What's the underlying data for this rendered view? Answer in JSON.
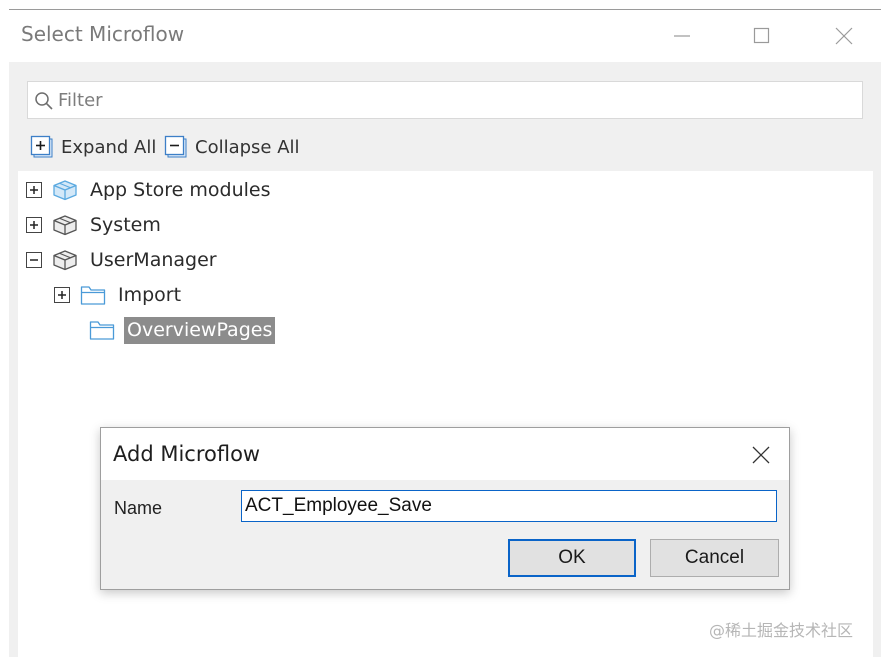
{
  "window": {
    "title": "Select Microflow"
  },
  "filter": {
    "placeholder": "Filter",
    "value": ""
  },
  "toolbar": {
    "expand_all": "Expand All",
    "collapse_all": "Collapse All"
  },
  "tree": {
    "items": [
      {
        "label": "App Store modules",
        "icon": "module-box-icon",
        "expander": "expand"
      },
      {
        "label": "System",
        "icon": "module-box-icon",
        "expander": "expand"
      },
      {
        "label": "UserManager",
        "icon": "module-box-icon",
        "expander": "collapse"
      },
      {
        "label": "Import",
        "icon": "folder-icon",
        "expander": "expand"
      },
      {
        "label": "OverviewPages",
        "icon": "folder-icon",
        "selected": true
      }
    ]
  },
  "dialog": {
    "title": "Add Microflow",
    "name_label": "Name",
    "name_value": "ACT_Employee_Save",
    "ok_label": "OK",
    "cancel_label": "Cancel"
  },
  "watermark": "@稀土掘金技术社区",
  "colors": {
    "selection_bg": "#8c8c8c",
    "accent_blue": "#0a64c8",
    "folder_icon": "#4a9ad8",
    "module_icon_appstore": "#5aa9e0",
    "module_icon_default": "#555555"
  }
}
